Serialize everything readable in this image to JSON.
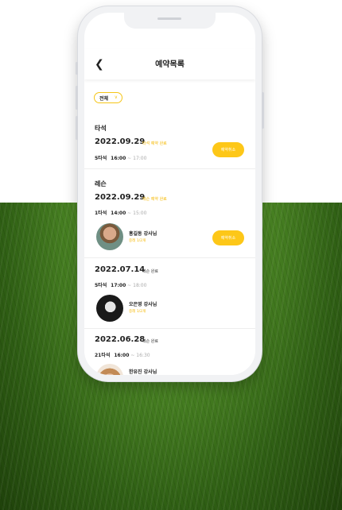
{
  "header": {
    "back_icon": "chevron-left-icon",
    "title": "예약목록"
  },
  "filter": {
    "label": "전체",
    "icon": "chevron-down-icon"
  },
  "colors": {
    "accent": "#fdc718",
    "status_yellow": "#f5b800"
  },
  "sections": [
    {
      "category": "타석",
      "date": "2022.09.29",
      "status": "타석 예약 완료",
      "bay": "5타석",
      "start": "16:00",
      "sep": "~",
      "end": "17:00",
      "button": "예약취소"
    },
    {
      "category": "레슨",
      "date": "2022.09.29",
      "status": "레슨 예약 완료",
      "bay": "1타석",
      "start": "14:00",
      "sep": "~",
      "end": "15:00",
      "coach": "홍길동 강사님",
      "level": "중레 1/2개",
      "button": "예약취소"
    },
    {
      "date": "2022.07.14",
      "status": "레슨 완료",
      "bay": "5타석",
      "start": "17:00",
      "sep": "~",
      "end": "18:00",
      "coach": "오은영 강사님",
      "level": "중레 1/2개"
    },
    {
      "date": "2022.06.28",
      "status": "레슨 완료",
      "bay": "21타석",
      "start": "16:00",
      "sep": "~",
      "end": "16:30",
      "coach": "한유진 강사님"
    }
  ]
}
